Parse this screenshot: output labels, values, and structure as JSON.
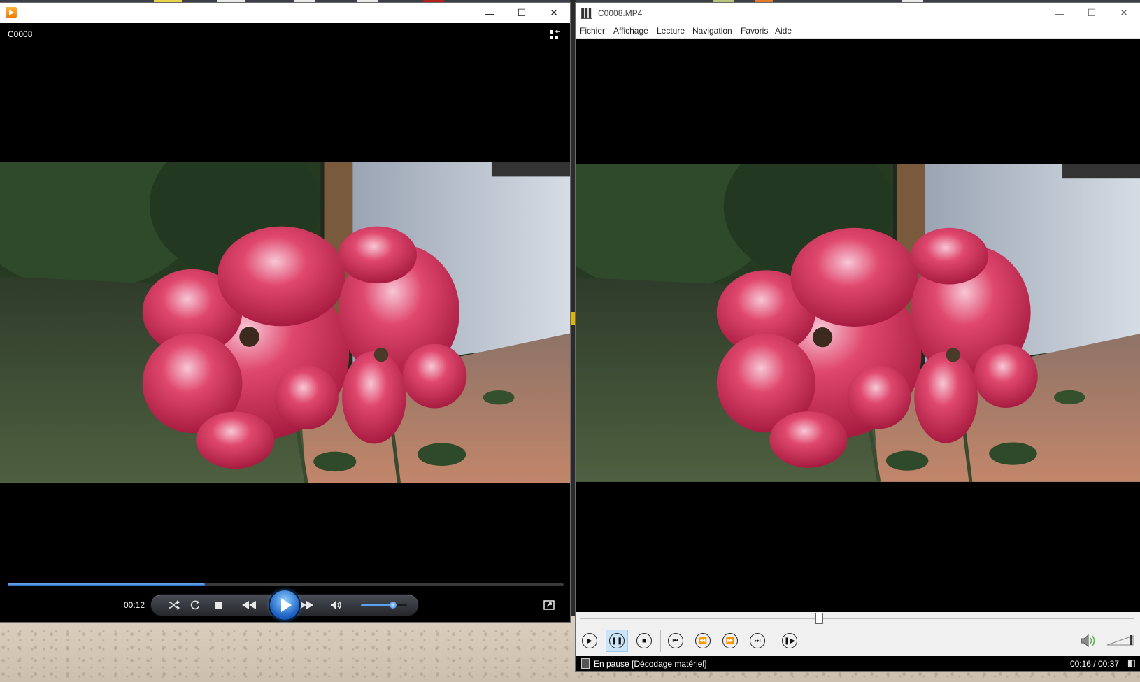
{
  "wmp": {
    "media_title": "C0008",
    "time": "00:12",
    "progress": 0.355,
    "volume": 0.7,
    "icons": [
      "switch-to-library-icon",
      "shuffle-icon",
      "repeat-icon",
      "stop-icon",
      "previous-icon",
      "play-icon",
      "next-icon",
      "volume-icon",
      "fullscreen-icon"
    ]
  },
  "mpc": {
    "window_title": "C0008.MP4",
    "menu": [
      "Fichier",
      "Affichage",
      "Lecture",
      "Navigation",
      "Favoris",
      "Aide"
    ],
    "seek_position": 0.43,
    "status_text": "En pause [Décodage matériel]",
    "time_display": "00:16 / 00:37",
    "active_button": "pause"
  },
  "colors": {
    "wmp_accent": "#2f6fc5",
    "mpc_active": "#cce4f7"
  }
}
